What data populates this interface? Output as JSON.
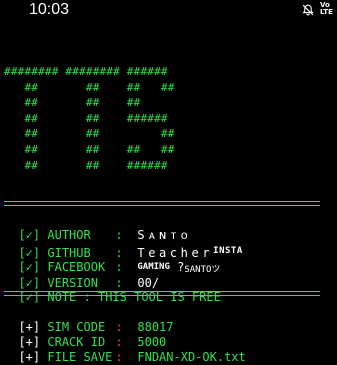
{
  "status_bar": {
    "time": "10:03",
    "network_label_top": "Vo",
    "network_label_bottom": "LTE",
    "icons": [
      "bell-off-icon",
      "volte-icon"
    ]
  },
  "banner": {
    "lines": [
      "######## ######## ######",
      "   ##       ##    ##   ##",
      "   ##       ##    ##",
      "   ##       ##    ######",
      "   ##       ##         ##",
      "   ##       ##    ##   ##",
      "   ##       ##    ######"
    ]
  },
  "info": {
    "bracket": "[✓]",
    "author_key": "AUTHOR",
    "author_value": "Sᴀɴᴛᴏ",
    "github_key": "GITHUB",
    "github_value": "Teacher",
    "github_suffix": "INSTA",
    "facebook_key": "FACEBOOK",
    "facebook_value_a": "GAMING",
    "facebook_value_b": "SANTOツ",
    "version_key": "VERSION",
    "version_value": "00/",
    "note_key": "NOTE",
    "note_value": "THIS TOOL IS FREE"
  },
  "details": {
    "bracket": "[+]",
    "sim_code_key": "SIM CODE",
    "sim_code_value": "88017",
    "crack_id_key": "CRACK ID",
    "crack_id_value": "5000",
    "file_save_key": "FILE SAVE",
    "file_save_value": "FNDAN-XD-OK.txt"
  },
  "colors": {
    "terminal_green": "#2fe14b",
    "background": "#000000",
    "text_white": "#ffffff",
    "accent_red": "#ff3b3b"
  }
}
